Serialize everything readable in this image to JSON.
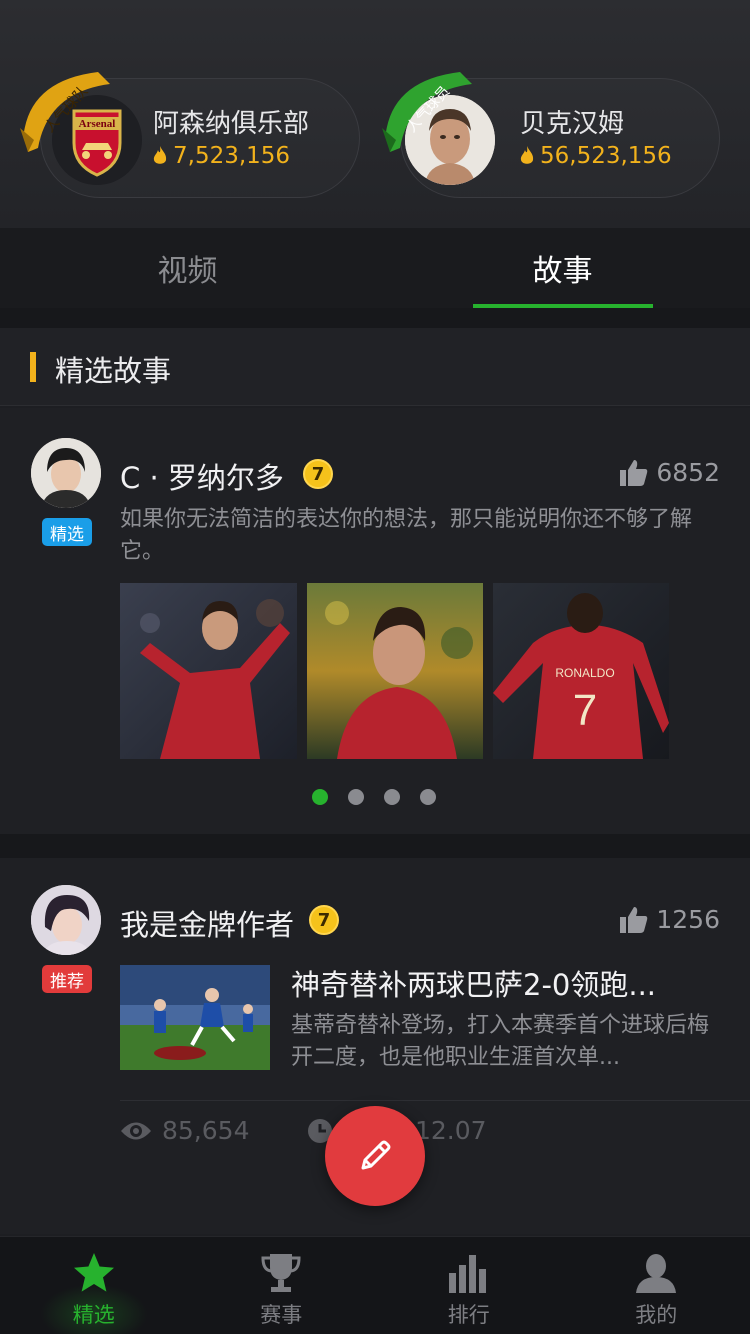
{
  "header": {
    "team": {
      "ribbon_label": "人气球队",
      "ribbon_color": "#e0a313",
      "logo_text": "Arsenal",
      "name": "阿森纳俱乐部",
      "score": "7,523,156"
    },
    "player": {
      "ribbon_label": "人气球员",
      "ribbon_color": "#2fa32f",
      "name": "贝克汉姆",
      "score": "56,523,156"
    }
  },
  "tabs": [
    {
      "label": "视频",
      "active": false
    },
    {
      "label": "故事",
      "active": true
    }
  ],
  "section": {
    "title": "精选故事"
  },
  "stories": [
    {
      "author": "C · 罗纳尔多",
      "badge": "精选",
      "level": "7",
      "likes": "6852",
      "excerpt": "如果你无法简洁的表达你的想法，那只能说明你还不够了解它。",
      "images": [
        "celebrating-player",
        "player-profile",
        "player-back-number-7"
      ],
      "jersey_text": "RONALDO",
      "jersey_number": "7",
      "carousel": {
        "count": 4,
        "active_index": 0
      }
    },
    {
      "author": "我是金牌作者",
      "badge": "推荐",
      "level": "7",
      "likes": "1256",
      "title": "神奇替补两球巴萨2-0领跑...",
      "excerpt": "基蒂奇替补登场，打入本赛季首个进球后梅开二度，也是他职业生涯首次单...",
      "views": "85,654",
      "date": "12.07"
    }
  ],
  "bottom_nav": [
    {
      "label": "精选",
      "icon": "star-icon",
      "active": true
    },
    {
      "label": "赛事",
      "icon": "trophy-icon",
      "active": false
    },
    {
      "label": "排行",
      "icon": "bar-chart-icon",
      "active": false
    },
    {
      "label": "我的",
      "icon": "user-icon",
      "active": false
    }
  ],
  "colors": {
    "accent_green": "#27b22e",
    "gold": "#f2b21c",
    "fab_red": "#e13b3e",
    "badge_blue": "#1a9ee8",
    "badge_red": "#e23b3b"
  }
}
